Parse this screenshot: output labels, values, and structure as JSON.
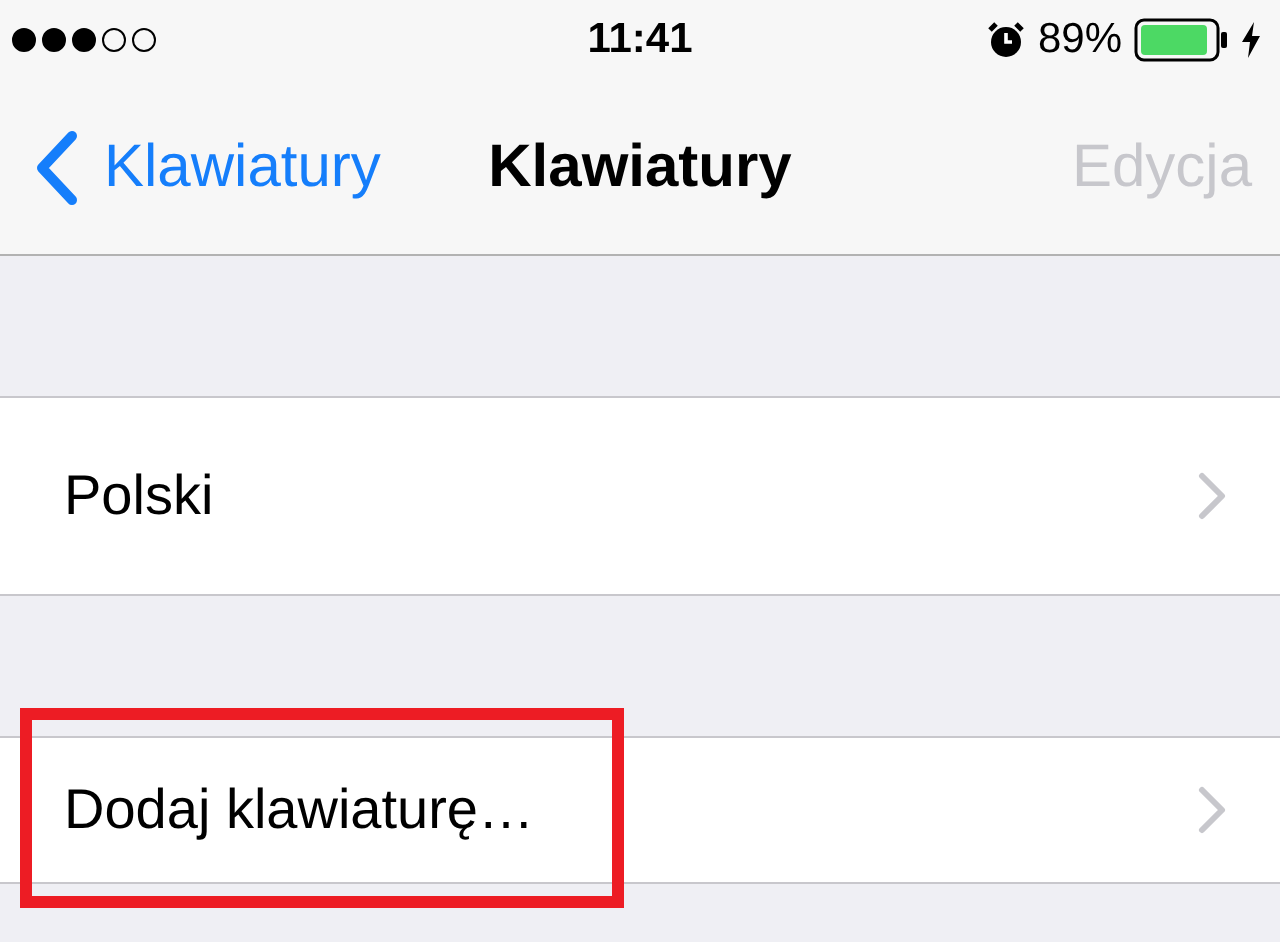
{
  "status_bar": {
    "signal_dots": [
      {
        "filled": true
      },
      {
        "filled": true
      },
      {
        "filled": true
      },
      {
        "filled": false
      },
      {
        "filled": false
      }
    ],
    "time": "11:41",
    "alarm": true,
    "battery_percent": "89%",
    "charging": true
  },
  "nav_bar": {
    "back_label": "Klawiatury",
    "title": "Klawiatury",
    "edit_button": {
      "label": "Edycja",
      "disabled": true
    }
  },
  "sections": [
    {
      "rows": [
        {
          "label": "Polski",
          "highlighted": false
        }
      ]
    },
    {
      "rows": [
        {
          "label": "Dodaj klawiaturę…",
          "highlighted": true
        }
      ]
    }
  ]
}
